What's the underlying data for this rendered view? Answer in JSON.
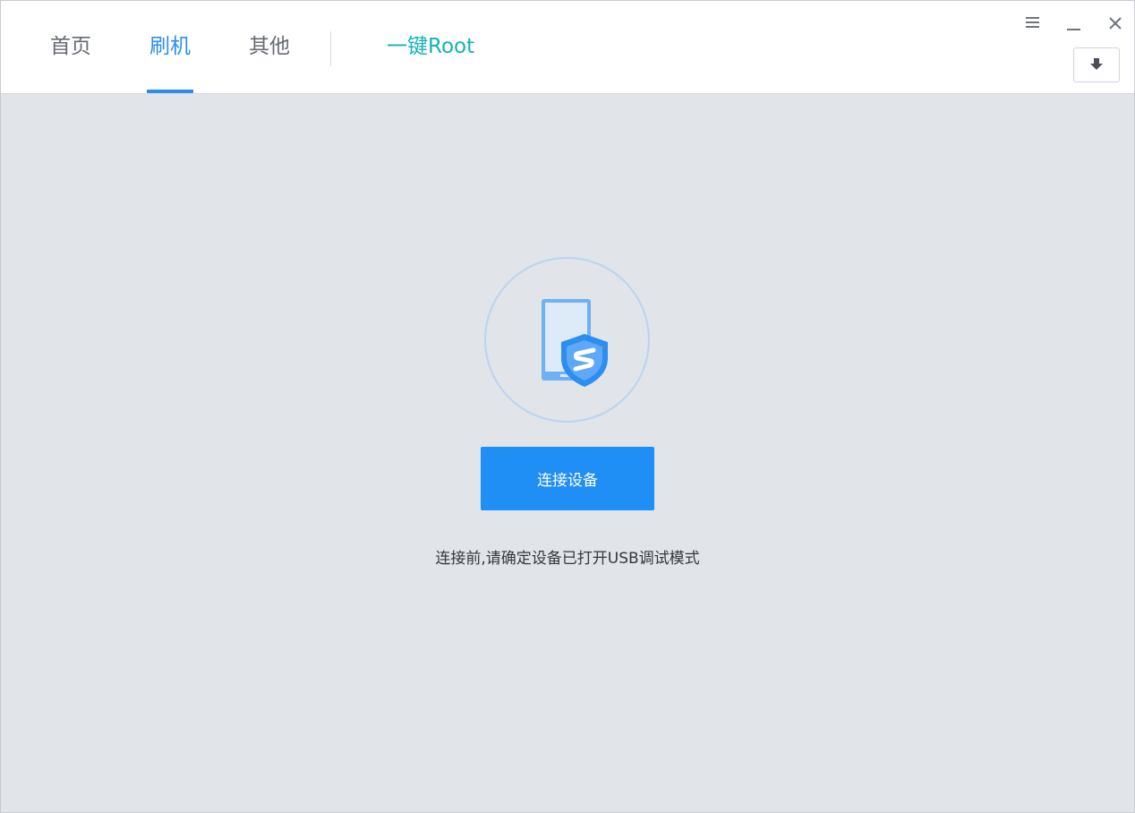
{
  "tabs": [
    {
      "label": "首页"
    },
    {
      "label": "刷机"
    },
    {
      "label": "其他"
    },
    {
      "label": "一键Root"
    }
  ],
  "active_tab": "刷机",
  "colors": {
    "accent": "#2b8ef0",
    "root_tab": "#14b2b6",
    "button": "#1f8ef5",
    "content_bg": "#e1e4e8"
  },
  "window_controls": {
    "menu_icon": "hamburger-menu-icon",
    "minimize_icon": "minimize-icon",
    "close_icon": "close-icon",
    "download_icon": "download-arrow-icon"
  },
  "main": {
    "device_icon": "phone-shield-icon",
    "connect_button_label": "连接设备",
    "hint": "连接前,请确定设备已打开USB调试模式"
  }
}
